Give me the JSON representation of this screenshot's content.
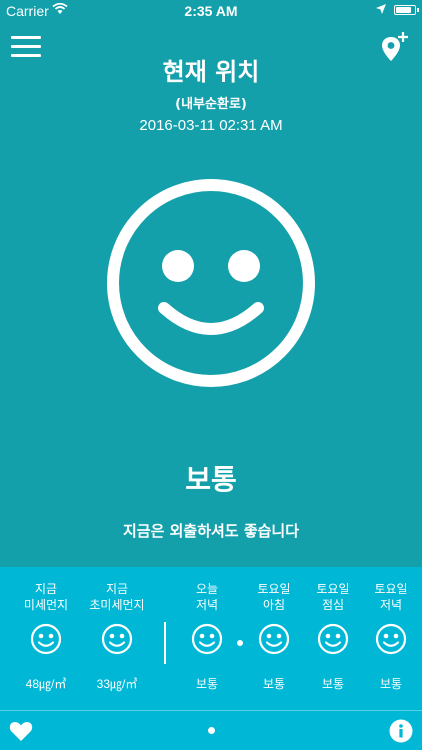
{
  "status_bar": {
    "carrier": "Carrier",
    "time": "2:35 AM",
    "battery_level": 0.9
  },
  "header": {
    "title": "현재 위치",
    "subtitle": "(내부순환로)",
    "datetime": "2016-03-11 02:31 AM"
  },
  "main": {
    "face_icon": "smiley-icon",
    "status": "보통",
    "advice": "지금은 외출하셔도 좋습니다"
  },
  "panel": {
    "current": [
      {
        "label_1": "지금",
        "label_2": "미세먼지",
        "value": "48㎍/㎥",
        "icon": "smiley-icon"
      },
      {
        "label_1": "지금",
        "label_2": "초미세먼지",
        "value": "33㎍/㎥",
        "icon": "smiley-icon"
      }
    ],
    "forecast": [
      {
        "label_1": "오늘",
        "label_2": "저녁",
        "value": "보통",
        "icon": "smiley-icon"
      },
      {
        "label_1": "토요일",
        "label_2": "아침",
        "value": "보통",
        "icon": "smiley-icon"
      },
      {
        "label_1": "토요일",
        "label_2": "점심",
        "value": "보통",
        "icon": "smiley-icon"
      },
      {
        "label_1": "토요일",
        "label_2": "저녁",
        "value": "보통",
        "icon": "smiley-icon"
      }
    ]
  },
  "colors": {
    "background": "#14a0aa",
    "panel": "#00b8d6",
    "foreground": "#ffffff"
  },
  "icons": [
    "menu-icon",
    "add-location-icon",
    "smiley-icon",
    "heart-icon",
    "info-icon"
  ]
}
